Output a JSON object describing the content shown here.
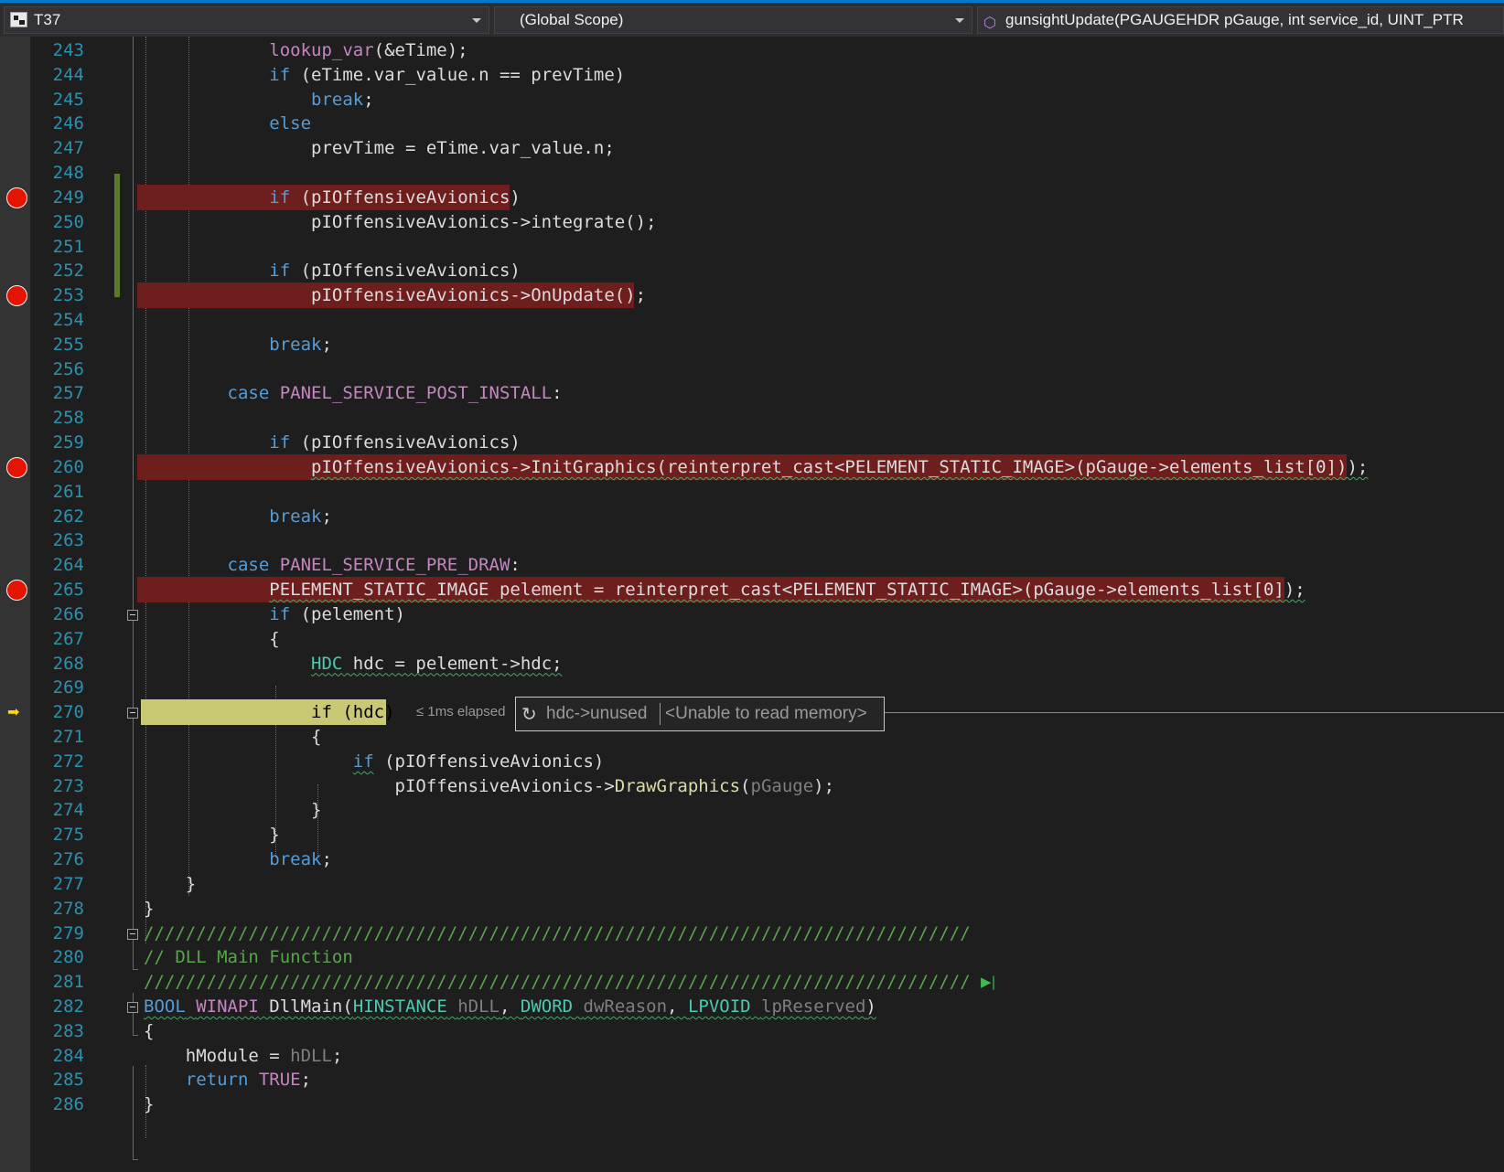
{
  "navbar": {
    "project": "T37",
    "scope": "(Global Scope)",
    "function": "gunsightUpdate(PGAUGEHDR pGauge, int service_id, UINT_PTR"
  },
  "lines": [
    {
      "n": "243",
      "t": [
        [
          "            ",
          ""
        ],
        [
          "lookup_var",
          "mac"
        ],
        [
          "(&eTime);",
          ""
        ]
      ]
    },
    {
      "n": "244",
      "t": [
        [
          "            ",
          ""
        ],
        [
          "if",
          "kw"
        ],
        [
          " (eTime.var_value.n == prevTime)",
          ""
        ]
      ]
    },
    {
      "n": "245",
      "t": [
        [
          "                ",
          ""
        ],
        [
          "break",
          "kw"
        ],
        [
          ";",
          ""
        ]
      ]
    },
    {
      "n": "246",
      "t": [
        [
          "            ",
          ""
        ],
        [
          "else",
          "kw"
        ]
      ]
    },
    {
      "n": "247",
      "t": [
        [
          "                prevTime = eTime.var_value.n;",
          ""
        ]
      ]
    },
    {
      "n": "248",
      "t": []
    },
    {
      "n": "249",
      "t": [
        [
          "            ",
          ""
        ],
        [
          "if",
          "kw"
        ],
        [
          " (pIOffensiveAvionics)",
          ""
        ]
      ]
    },
    {
      "n": "250",
      "t": [
        [
          "                pIOffensiveAvionics->integrate();",
          ""
        ]
      ]
    },
    {
      "n": "251",
      "t": []
    },
    {
      "n": "252",
      "t": [
        [
          "            ",
          ""
        ],
        [
          "if",
          "kw"
        ],
        [
          " (pIOffensiveAvionics)",
          ""
        ]
      ]
    },
    {
      "n": "253",
      "t": [
        [
          "                pIOffensiveAvionics->OnUpdate();",
          ""
        ]
      ]
    },
    {
      "n": "254",
      "t": []
    },
    {
      "n": "255",
      "t": [
        [
          "            ",
          ""
        ],
        [
          "break",
          "kw"
        ],
        [
          ";",
          ""
        ]
      ]
    },
    {
      "n": "256",
      "t": []
    },
    {
      "n": "257",
      "t": [
        [
          "        ",
          ""
        ],
        [
          "case",
          "kw"
        ],
        [
          " ",
          ""
        ],
        [
          "PANEL_SERVICE_POST_INSTALL",
          "mac"
        ],
        [
          ":",
          ""
        ]
      ]
    },
    {
      "n": "258",
      "t": []
    },
    {
      "n": "259",
      "t": [
        [
          "            ",
          ""
        ],
        [
          "if",
          "kw"
        ],
        [
          " (pIOffensiveAvionics)",
          ""
        ]
      ]
    },
    {
      "n": "260",
      "t": [
        [
          "                ",
          ""
        ],
        [
          "pIOffensiveAvionics->InitGraphics(reinterpret_cast<PELEMENT_STATIC_IMAGE>(pGauge->elements_list[0]));",
          "sq"
        ]
      ]
    },
    {
      "n": "261",
      "t": []
    },
    {
      "n": "262",
      "t": [
        [
          "            ",
          ""
        ],
        [
          "break",
          "kw"
        ],
        [
          ";",
          ""
        ]
      ]
    },
    {
      "n": "263",
      "t": []
    },
    {
      "n": "264",
      "t": [
        [
          "        ",
          ""
        ],
        [
          "case",
          "kw"
        ],
        [
          " ",
          ""
        ],
        [
          "PANEL_SERVICE_PRE_DRAW",
          "mac"
        ],
        [
          ":",
          ""
        ]
      ]
    },
    {
      "n": "265",
      "t": [
        [
          "            ",
          ""
        ],
        [
          "PELEMENT_STATIC_IMAGE pelement = reinterpret_cast<PELEMENT_STATIC_IMAGE>(pGauge->elements_list[0]);",
          "sq"
        ]
      ]
    },
    {
      "n": "266",
      "t": [
        [
          "            ",
          ""
        ],
        [
          "if",
          "kw"
        ],
        [
          " (pelement)",
          ""
        ]
      ]
    },
    {
      "n": "267",
      "t": [
        [
          "            {",
          ""
        ]
      ]
    },
    {
      "n": "268",
      "t": [
        [
          "                ",
          ""
        ],
        [
          "HDC",
          "ty sqg"
        ],
        [
          " hdc = pelement->hdc;",
          "sqg"
        ]
      ]
    },
    {
      "n": "269",
      "t": []
    },
    {
      "n": "270",
      "t": [
        [
          "                ",
          ""
        ],
        [
          "if (hdc)",
          "dark"
        ]
      ]
    },
    {
      "n": "271",
      "t": [
        [
          "                {",
          ""
        ]
      ]
    },
    {
      "n": "272",
      "t": [
        [
          "                    ",
          ""
        ],
        [
          "if",
          "kw sqg"
        ],
        [
          " (pIOffensiveAvionics)",
          ""
        ]
      ]
    },
    {
      "n": "273",
      "t": [
        [
          "                        pIOffensiveAvionics->",
          ""
        ],
        [
          "DrawGraphics",
          "fn"
        ],
        [
          "(",
          ""
        ],
        [
          "pGauge",
          "pm"
        ],
        [
          ");",
          ""
        ]
      ]
    },
    {
      "n": "274",
      "t": [
        [
          "                }",
          ""
        ]
      ]
    },
    {
      "n": "275",
      "t": [
        [
          "            }",
          ""
        ]
      ]
    },
    {
      "n": "276",
      "t": [
        [
          "            ",
          ""
        ],
        [
          "break",
          "kw"
        ],
        [
          ";",
          ""
        ]
      ]
    },
    {
      "n": "277",
      "t": [
        [
          "    }",
          ""
        ]
      ]
    },
    {
      "n": "278",
      "t": [
        [
          "}",
          ""
        ]
      ]
    },
    {
      "n": "279",
      "t": [
        [
          "///////////////////////////////////////////////////////////////////////////////",
          "cm"
        ]
      ]
    },
    {
      "n": "280",
      "t": [
        [
          "// DLL Main Function",
          "cm"
        ]
      ]
    },
    {
      "n": "281",
      "t": [
        [
          "///////////////////////////////////////////////////////////////////////////////",
          "cm"
        ]
      ]
    },
    {
      "n": "282",
      "t": [
        [
          "BOOL",
          "kw sqg"
        ],
        [
          " ",
          "sqg"
        ],
        [
          "WINAPI",
          "mac sqg"
        ],
        [
          " DllMain(",
          "sqg"
        ],
        [
          "HINSTANCE",
          "ty sqg"
        ],
        [
          " ",
          "sqg"
        ],
        [
          "hDLL",
          "pm sqg"
        ],
        [
          ", ",
          "sqg"
        ],
        [
          "DWORD",
          "ty sqg"
        ],
        [
          " ",
          "sqg"
        ],
        [
          "dwReason",
          "pm sqg"
        ],
        [
          ", ",
          "sqg"
        ],
        [
          "LPVOID",
          "ty sqg"
        ],
        [
          " ",
          "sqg"
        ],
        [
          "lpReserved",
          "pm sqg"
        ],
        [
          ")",
          "sqg"
        ]
      ]
    },
    {
      "n": "283",
      "t": [
        [
          "{",
          ""
        ]
      ]
    },
    {
      "n": "284",
      "t": [
        [
          "    hModule = ",
          ""
        ],
        [
          "hDLL",
          "pm"
        ],
        [
          ";",
          ""
        ]
      ]
    },
    {
      "n": "285",
      "t": [
        [
          "    ",
          ""
        ],
        [
          "return",
          "kw"
        ],
        [
          " ",
          ""
        ],
        [
          "TRUE",
          "mac"
        ],
        [
          ";",
          ""
        ]
      ]
    },
    {
      "n": "286",
      "t": [
        [
          "}",
          ""
        ]
      ]
    }
  ],
  "breakpoint_lines": [
    "249",
    "253",
    "260",
    "265"
  ],
  "current_line": "270",
  "perf_tip": "≤ 1ms elapsed",
  "datatip": {
    "name": "hdc->unused",
    "value": "<Unable to read memory>"
  },
  "colors": {
    "keyword": "#569cd6",
    "macro": "#c586c0",
    "type": "#4ec9b0",
    "comment": "#57a64a",
    "breakpoint": "#e51400",
    "current": "#c9c975"
  }
}
